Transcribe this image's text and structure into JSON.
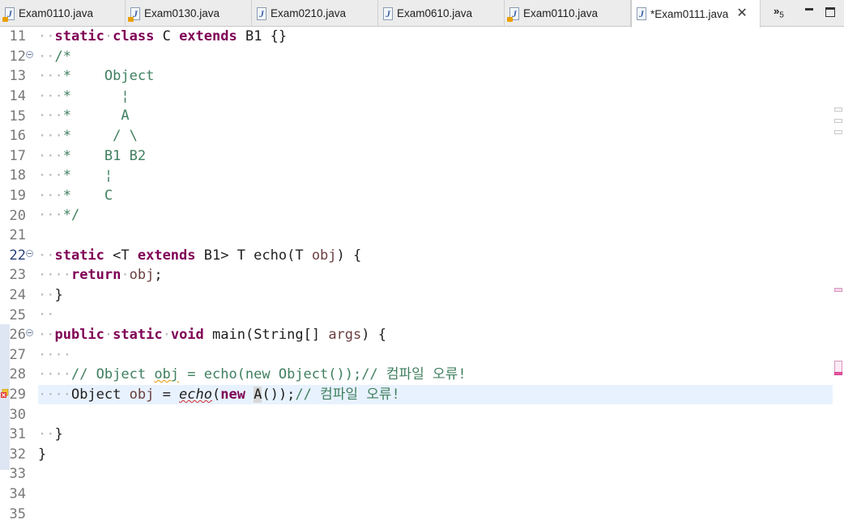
{
  "tabs": [
    {
      "label": "Exam0110.java",
      "active": false
    },
    {
      "label": "Exam0130.java",
      "active": false
    },
    {
      "label": "Exam0210.java",
      "active": false
    },
    {
      "label": "Exam0610.java",
      "active": false
    },
    {
      "label": "Exam0110.java",
      "active": false
    },
    {
      "label": "*Exam0111.java",
      "active": true
    }
  ],
  "tab_overflow": {
    "glyph": "»",
    "count": "5"
  },
  "icons": {
    "java_file": "java-file-icon",
    "close": "close-icon",
    "minimize": "minimize-icon",
    "maximize": "maximize-icon",
    "fold": "fold-collapse-icon",
    "error": "error-marker-icon"
  },
  "line_numbers": [
    "11",
    "12",
    "13",
    "14",
    "15",
    "16",
    "17",
    "18",
    "19",
    "20",
    "21",
    "22",
    "23",
    "24",
    "25",
    "26",
    "27",
    "28",
    "29",
    "30",
    "31",
    "32",
    "33",
    "34",
    "35"
  ],
  "code": {
    "l11": [
      "static",
      "class",
      " C ",
      "extends",
      " B1 {}"
    ],
    "l12": "/*",
    "l13": "*    Object",
    "l14": "*      ¦",
    "l15": "*      A",
    "l16": "*     / \\",
    "l17": "*    B1 B2",
    "l18": "*    ¦",
    "l19": "*    C",
    "l20": "*/",
    "l22": [
      "static",
      " <T ",
      "extends",
      " B1> T echo(T ",
      "obj",
      ") {"
    ],
    "l23": [
      "return",
      "obj",
      ";"
    ],
    "l24": "}",
    "l26": [
      "public",
      "static",
      "void",
      " main(String[] ",
      "args",
      ") {"
    ],
    "l28": [
      "// Object ",
      "obj",
      " = echo(new Object());// 컴파일 오류!"
    ],
    "l29": [
      "Object ",
      "obj",
      " = ",
      "echo",
      "(",
      "new",
      " ",
      "A",
      "());",
      "// 컴파일 오류!"
    ],
    "l31": "}",
    "l32": "}"
  },
  "colors": {
    "keyword": "#7f0055",
    "comment": "#3f7f5f",
    "variable": "#6a3e3e",
    "current_line": "#e8f2fe",
    "line_number": "#787878"
  }
}
